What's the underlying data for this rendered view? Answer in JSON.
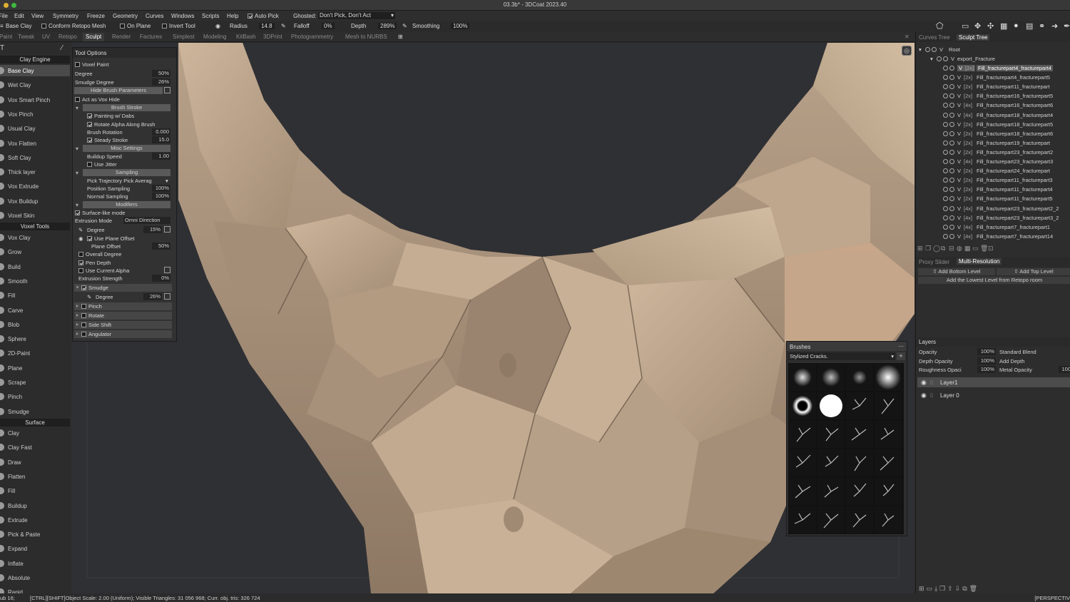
{
  "window": {
    "title": "03.3b* - 3DCoat 2023.40"
  },
  "menu": [
    "File",
    "Edit",
    "View",
    "Symmetry",
    "Freeze",
    "Geometry",
    "Curves",
    "Windows",
    "Scripts",
    "Help"
  ],
  "menu_autopick": "Auto Pick",
  "menu_ghosted_label": "Ghosted:",
  "menu_ghosted_value": "Don't Pick, Don't Act",
  "toolbar": {
    "tool_name": "Base Clay",
    "conform": "Conform Retopo Mesh",
    "on_plane": "On Plane",
    "invert": "Invert Tool",
    "radius_label": "Radius",
    "radius_value": "14.8",
    "falloff_label": "Falloff",
    "falloff_value": "0%",
    "depth_label": "Depth",
    "depth_value": "289%",
    "smoothing_label": "Smoothing",
    "smoothing_value": "100%"
  },
  "rooms": [
    "Paint",
    "Tweak",
    "UV",
    "Retopo",
    "Sculpt",
    "Render",
    "Factures",
    "Simplest",
    "Modeling",
    "KitBash",
    "3DPrint",
    "Photogrammetry",
    "Mesh to NURBS"
  ],
  "active_room": "Sculpt",
  "tool_groups": {
    "clay_engine": "Clay Engine",
    "voxel_tools": "Voxel Tools",
    "surface": "Surface"
  },
  "tools_clay": [
    "Base Clay",
    "Wet Clay",
    "Vox Smart Pinch",
    "Vox Pinch",
    "Usual Clay",
    "Vox Flatten",
    "Soft Clay",
    "Thick layer",
    "Vox Extrude",
    "Vox Buildup",
    "Voxel Skin"
  ],
  "tools_voxel": [
    "Vox Clay",
    "Grow",
    "Build",
    "Smooth",
    "Fill",
    "Carve",
    "Blob",
    "Sphere",
    "2D-Paint",
    "Plane",
    "Scrape",
    "Pinch",
    "Smudge"
  ],
  "tools_surface": [
    "Clay",
    "Clay Fast",
    "Draw",
    "Flatten",
    "Fill",
    "Buildup",
    "Extrude",
    "Pick & Paste",
    "Expand",
    "Inflate",
    "Absolute",
    "Rapid"
  ],
  "tool_options": {
    "title": "Tool Options",
    "voxel_paint": "Voxel Paint",
    "degree_label": "Degree",
    "degree_value": "50%",
    "smudge_degree_label": "Smudge Degree",
    "smudge_degree_value": "26%",
    "hide_brush_params": "Hide Brush Parameters",
    "act_as_vox_hide": "Act as Vox Hide",
    "brush_stroke": "Brush Stroke",
    "painting_w_dabs": "Painting w/ Dabs",
    "rotate_alpha": "Rotate Alpha Along Brush",
    "brush_rotation_label": "Brush Rotation",
    "brush_rotation_value": "0.000",
    "steady_stroke_label": "Steady Stroke",
    "steady_stroke_value": "15.0",
    "misc_settings": "Misc Settings",
    "buildup_speed_label": "Buildup Speed",
    "buildup_speed_value": "1.00",
    "use_jitter": "Use Jitter",
    "sampling": "Sampling",
    "pick_trajectory": "Pick Trajectory Pick Averag",
    "position_sampling_label": "Position Sampling",
    "position_sampling_value": "100%",
    "normal_sampling_label": "Normal Sampling",
    "normal_sampling_value": "100%",
    "modifiers": "Modifiers",
    "surface_like": "Surface-like mode",
    "extrusion_mode_label": "Extrusion Mode",
    "extrusion_mode_value": "Omni Direction",
    "mod_degree_label": "Degree",
    "mod_degree_value": "15%",
    "use_plane_offset": "Use Plane Offset",
    "plane_offset_label": "Plane Offset",
    "plane_offset_value": "50%",
    "overall_degree": "Overall Degree",
    "pen_depth": "Pen Depth",
    "use_current_alpha": "Use Current Alpha",
    "extrusion_strength_label": "Extrusion Strength",
    "extrusion_strength_value": "0%",
    "smudge": "Smudge",
    "smudge_degree2_label": "Degree",
    "smudge_degree2_value": "26%",
    "pinch": "Pinch",
    "rotate": "Rotate",
    "side_shift": "Side Shift",
    "angulator": "Angulator"
  },
  "right_tabs": [
    "Curves Tree",
    "Sculpt Tree"
  ],
  "right_active_tab": "Sculpt Tree",
  "tree": {
    "root": "Root",
    "group": "export_Fracture",
    "items": [
      {
        "count": "[2x]",
        "name": "Fill_fracturepart4_fracturepart4"
      },
      {
        "count": "[2x]",
        "name": "Fill_fracturepart4_fracturepart5"
      },
      {
        "count": "[2x]",
        "name": "Fill_fracturepart11_fracturepart"
      },
      {
        "count": "[2x]",
        "name": "Fill_fracturepart16_fracturepart5"
      },
      {
        "count": "[4x]",
        "name": "Fill_fracturepart16_fracturepart6"
      },
      {
        "count": "[4x]",
        "name": "Fill_fracturepart18_fracturepart4"
      },
      {
        "count": "[2x]",
        "name": "Fill_fracturepart18_fracturepart5"
      },
      {
        "count": "[2x]",
        "name": "Fill_fracturepart18_fracturepart6"
      },
      {
        "count": "[2x]",
        "name": "Fill_fracturepart19_fracturepart"
      },
      {
        "count": "[2x]",
        "name": "Fill_fracturepart23_fracturepart2"
      },
      {
        "count": "[4x]",
        "name": "Fill_fracturepart23_fracturepart3"
      },
      {
        "count": "[2x]",
        "name": "Fill_fracturepart24_fracturepart"
      },
      {
        "count": "[2x]",
        "name": "Fill_fracturepart11_fracturepart3"
      },
      {
        "count": "[2x]",
        "name": "Fill_fracturepart11_fracturepart4"
      },
      {
        "count": "[2x]",
        "name": "Fill_fracturepart11_fracturepart5"
      },
      {
        "count": "[4x]",
        "name": "Fill_fracturepart23_fracturepart2_2"
      },
      {
        "count": "[4x]",
        "name": "Fill_fracturepart23_fracturepart3_2"
      },
      {
        "count": "[4x]",
        "name": "Fill_fracturepart7_fracturepart1"
      },
      {
        "count": "[4x]",
        "name": "Fill_fracturepart7_fracturepart14"
      }
    ]
  },
  "proxy_tabs": [
    "Proxy Slider",
    "Multi-Resolution"
  ],
  "proxy_active": "Multi-Resolution",
  "multires": {
    "add_bottom": "Add Bottom Level",
    "add_top": "Add Top Level",
    "add_lowest": "Add the Lowest Level from Retopo room"
  },
  "layers": {
    "title": "Layers",
    "opacity_label": "Opacity",
    "opacity_value": "100%",
    "blend": "Standard Blend",
    "depth_opacity_label": "Depth Opacity",
    "depth_opacity_value": "100%",
    "add_depth": "Add Depth",
    "roughness_label": "Roughness Opaci",
    "roughness_value": "100%",
    "metal_label": "Metal Opacity",
    "metal_value": "100",
    "items": [
      "Layer1",
      "Layer 0"
    ]
  },
  "brushes": {
    "title": "Brushes",
    "category": "Stylized Cracks."
  },
  "status": {
    "left": "ub 16;",
    "text": "[CTRL][SHIFT]Object Scale: 2.00 (Uniform); Visible Triangles: 31 056 968; Curr. obj. tris: 326 724",
    "right": "[PERSPECTIV"
  },
  "colors": {
    "sculpt": "#bfa88f",
    "bg": "#2f3034",
    "accent": "#5a5a5a"
  }
}
